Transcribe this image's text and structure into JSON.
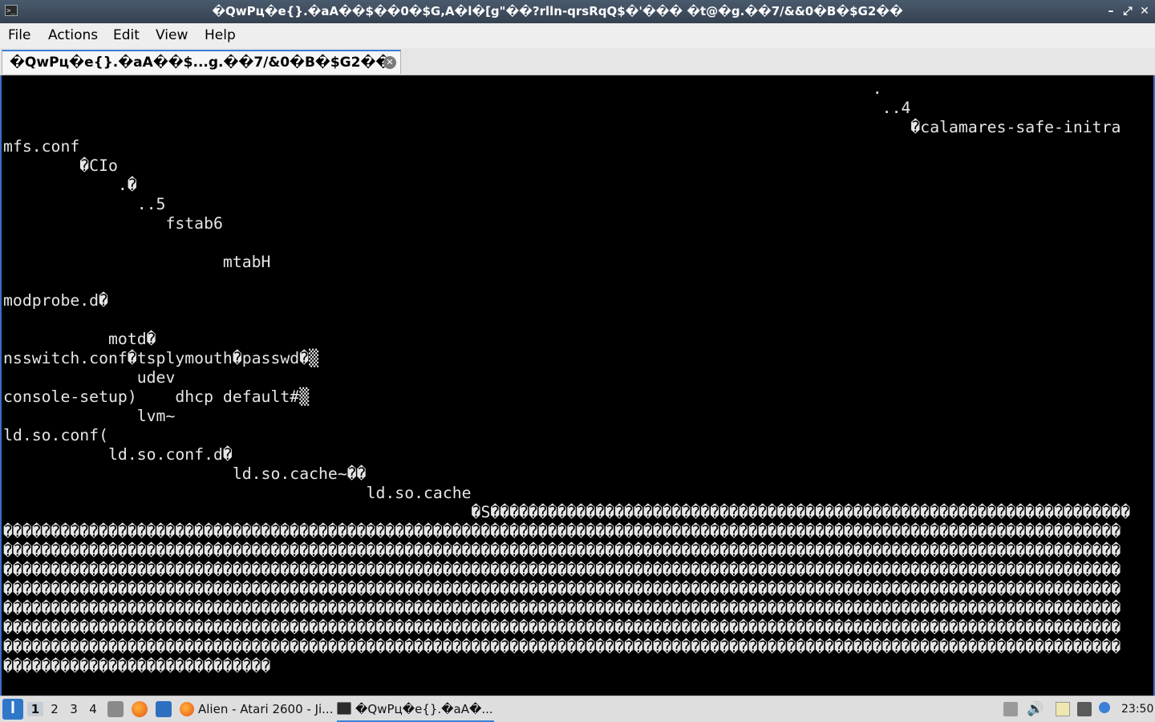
{
  "window": {
    "title": "�QwPц�e{}.�aA��$��0�$G,A�l�[g\"��?rlln-qrsRqQ$�'��� �t@�g.��7/&&0�B�$G2��",
    "minimize_label": "–",
    "maximize_label": "⤢",
    "close_label": "✕"
  },
  "menu": {
    "items": [
      "File",
      "Actions",
      "Edit",
      "View",
      "Help"
    ]
  },
  "tab": {
    "label": "�QwPц�e{}.�aA��$...g.��7/&0�B�$G2��",
    "close_label": "✕"
  },
  "terminal": {
    "lines": [
      "                                                                                           .",
      "                                                                                            ..4",
      "                                                                                               �calamares-safe-initra",
      "mfs.conf",
      "        �CIo",
      "            .�",
      "              ..5",
      "                 fstab6",
      "",
      "                       mtabH",
      "",
      "modprobe.d�",
      "",
      "           motd�",
      "nsswitch.conf�tsplymouth�passwd�▒",
      "              udev",
      "console-setup)    dhcp default#▒",
      "              lvm~",
      "ld.so.conf(",
      "           ld.so.conf.d�",
      "                        ld.so.cache~��",
      "                                      ld.so.cache",
      "                                                 �S�������������������������������������������������������������������",
      "���������������������������������������������������������������������������������������������������������������������",
      "���������������������������������������������������������������������������������������������������������������������",
      "���������������������������������������������������������������������������������������������������������������������",
      "���������������������������������������������������������������������������������������������������������������������",
      "���������������������������������������������������������������������������������������������������������������������",
      "���������������������������������������������������������������������������������������������������������������������",
      "���������������������������������������������������������������������������������������������������������������������",
      "����������������������������"
    ]
  },
  "taskbar": {
    "workspaces": [
      "1",
      "2",
      "3",
      "4"
    ],
    "active_workspace": "1",
    "tasks": [
      {
        "label": "Alien - Atari 2600 - Ji...",
        "icon": "firefox-icon"
      },
      {
        "label": "�QwPц�e{}.�aA�...",
        "icon": "terminal-icon"
      }
    ],
    "clock": "23:50"
  },
  "colors": {
    "terminal_bg": "#000000",
    "terminal_fg": "#e6e6e6",
    "accent": "#3b7fd6"
  }
}
